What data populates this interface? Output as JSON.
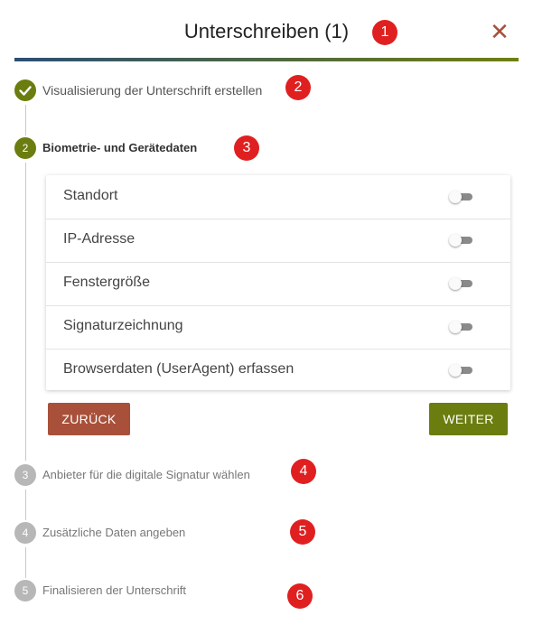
{
  "header": {
    "title": "Unterschreiben (1)",
    "close_label": "✕",
    "badge": "1"
  },
  "steps": [
    {
      "number": "1",
      "label": "Visualisierung der Unterschrift erstellen",
      "state": "done",
      "badge": "2"
    },
    {
      "number": "2",
      "label": "Biometrie- und Gerätedaten",
      "state": "active",
      "badge": "3"
    },
    {
      "number": "3",
      "label": "Anbieter für die digitale Signatur wählen",
      "state": "pending",
      "badge": "4"
    },
    {
      "number": "4",
      "label": "Zusätzliche Daten angeben",
      "state": "pending",
      "badge": "5"
    },
    {
      "number": "5",
      "label": "Finalisieren der Unterschrift",
      "state": "pending",
      "badge": "6"
    }
  ],
  "options": [
    {
      "label": "Standort",
      "enabled": false
    },
    {
      "label": "IP-Adresse",
      "enabled": false
    },
    {
      "label": "Fenstergröße",
      "enabled": false
    },
    {
      "label": "Signaturzeichnung",
      "enabled": false
    },
    {
      "label": "Browserdaten (UserAgent) erfassen",
      "enabled": false
    }
  ],
  "buttons": {
    "back": "ZURÜCK",
    "next": "WEITER"
  },
  "colors": {
    "accent_green": "#6b7d0f",
    "accent_red": "#a9503a",
    "badge_red": "#e02020",
    "pending_gray": "#b7b7b7"
  }
}
